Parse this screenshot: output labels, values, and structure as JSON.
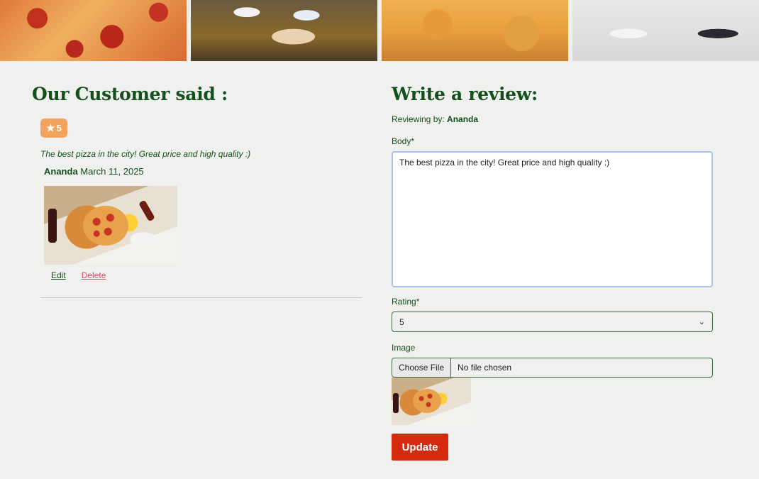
{
  "banner": {
    "images": [
      "pepperoni-pizza-photo",
      "friends-eating-pizza-photo",
      "cheese-pizza-photo",
      "people-holding-pizza-photo"
    ]
  },
  "reviews": {
    "heading": "Our Customer said :",
    "items": [
      {
        "rating": "5",
        "rating_icon": "star-icon",
        "body": "The best pizza in the city! Great price and high quality :)",
        "author": "Ananda",
        "date": "March 11, 2025",
        "image": "pizza-table-photo",
        "edit_label": "Edit",
        "delete_label": "Delete"
      }
    ]
  },
  "form": {
    "heading": "Write a review:",
    "reviewing_prefix": "Reviewing by:",
    "reviewing_user": "Ananda",
    "body_label": "Body*",
    "body_value": "The best pizza in the city! Great price and high quality :)",
    "rating_label": "Rating*",
    "rating_value": "5",
    "image_label": "Image",
    "file_button": "Choose File",
    "file_status": "No file chosen",
    "preview_image": "pizza-table-photo",
    "submit_label": "Update"
  },
  "colors": {
    "background": "#f0f0ee",
    "heading_green": "#13501c",
    "badge_orange": "#f2a35e",
    "delete_pink": "#d0506a",
    "button_red": "#d32a10"
  }
}
